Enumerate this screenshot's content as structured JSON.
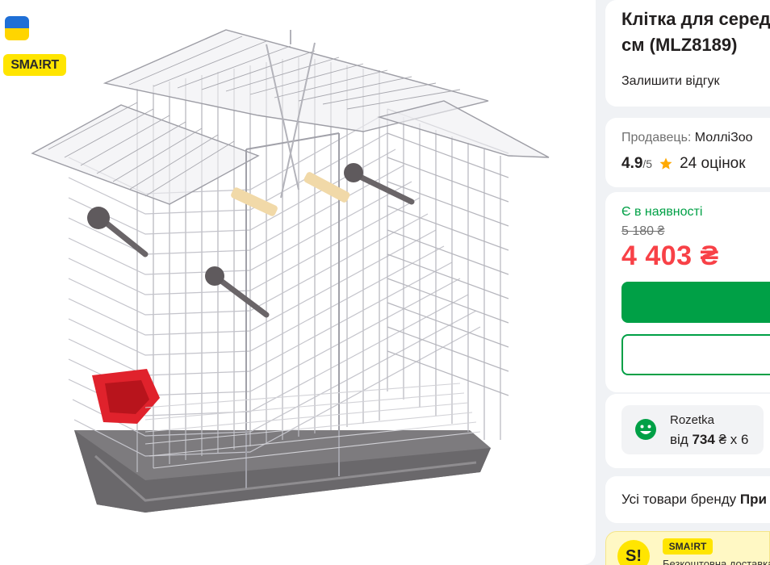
{
  "product": {
    "title_line1": "Клітка для серед",
    "title_line2": "см (MLZ8189)",
    "review_link": "Залишити відгук"
  },
  "seller": {
    "label": "Продавець:",
    "name": "МоллiЗоо"
  },
  "rating": {
    "value": "4.9",
    "scale": "/5",
    "count": "24 оцінок"
  },
  "availability": "Є в наявності",
  "price": {
    "old": "5 180 ₴",
    "current": "4 403 ₴"
  },
  "installment": {
    "provider": "Rozetka",
    "prefix": "від",
    "amount": "734",
    "suffix": "₴ x 6"
  },
  "brand_link": {
    "text": "Усі товари бренду",
    "brand": "При"
  },
  "smart": {
    "badge": "SMA!RT",
    "coin": "S!",
    "mini_badge": "SMA!RT",
    "text": "Безкоштовна доставка"
  },
  "colors": {
    "accent_green": "#00a046",
    "price_red": "#f84147",
    "smart_yellow": "#ffe500",
    "star": "#ffa900"
  },
  "icons": [
    "ukraine-flag-icon",
    "star-icon",
    "rozetka-smile-icon"
  ]
}
